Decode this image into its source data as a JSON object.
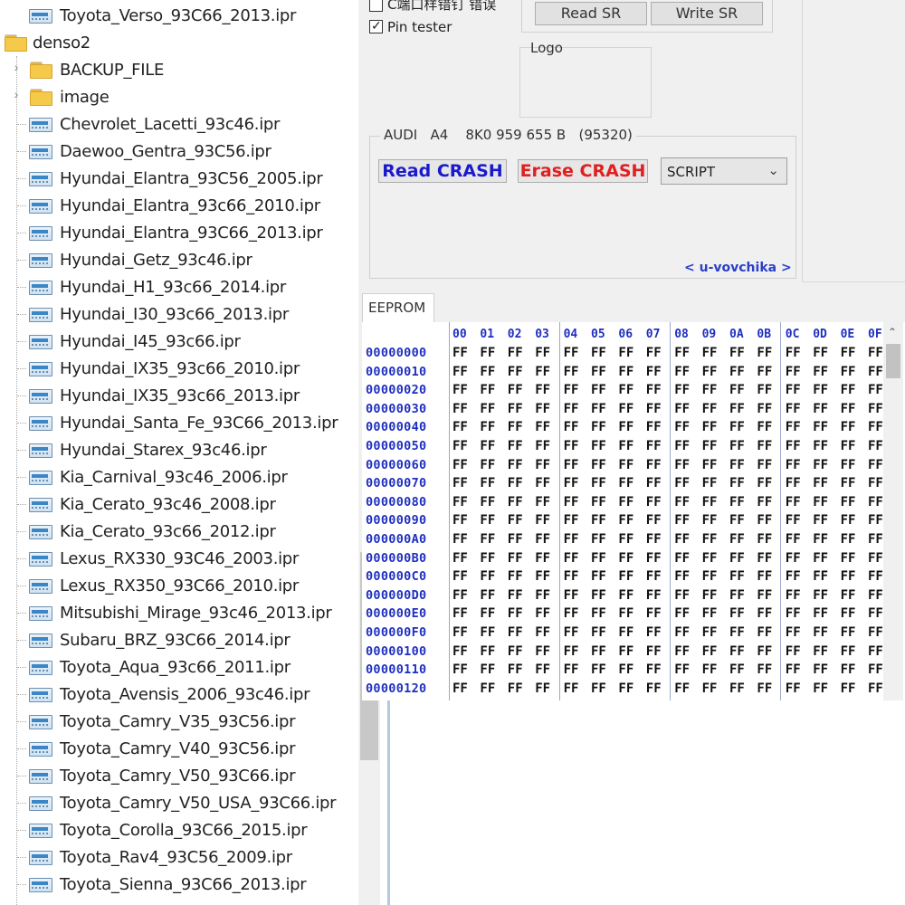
{
  "tree": {
    "top_file": "Toyota_Verso_93C66_2013.ipr",
    "root_folder": "denso2",
    "folders": [
      "BACKUP_FILE",
      "image"
    ],
    "files": [
      "Chevrolet_Lacetti_93c46.ipr",
      "Daewoo_Gentra_93C56.ipr",
      "Hyundai_Elantra_93C56_2005.ipr",
      "Hyundai_Elantra_93c66_2010.ipr",
      "Hyundai_Elantra_93C66_2013.ipr",
      "Hyundai_Getz_93c46.ipr",
      "Hyundai_H1_93c66_2014.ipr",
      "Hyundai_I30_93c66_2013.ipr",
      "Hyundai_I45_93c66.ipr",
      "Hyundai_IX35_93c66_2010.ipr",
      "Hyundai_IX35_93c66_2013.ipr",
      "Hyundai_Santa_Fe_93C66_2013.ipr",
      "Hyundai_Starex_93c46.ipr",
      "Kia_Carnival_93c46_2006.ipr",
      "Kia_Cerato_93c46_2008.ipr",
      "Kia_Cerato_93c66_2012.ipr",
      "Lexus_RX330_93C46_2003.ipr",
      "Lexus_RX350_93C66_2010.ipr",
      "Mitsubishi_Mirage_93c46_2013.ipr",
      "Subaru_BRZ_93C66_2014.ipr",
      "Toyota_Aqua_93c66_2011.ipr",
      "Toyota_Avensis_2006_93c46.ipr",
      "Toyota_Camry_V35_93C56.ipr",
      "Toyota_Camry_V40_93C56.ipr",
      "Toyota_Camry_V50_93C66.ipr",
      "Toyota_Camry_V50_USA_93C66.ipr",
      "Toyota_Corolla_93C66_2015.ipr",
      "Toyota_Rav4_93C56_2009.ipr",
      "Toyota_Sienna_93C66_2013.ipr"
    ]
  },
  "controls": {
    "partial_checkbox_label": "C端口样错钉 错误",
    "pin_tester_label": "Pin tester",
    "pin_tester_checked": true,
    "read_sr": "Read SR",
    "write_sr": "Write SR",
    "logo_label": "Logo",
    "car_info": "AUDI   A4    8K0 959 655 B   (95320)",
    "read_crash": "Read CRASH",
    "erase_crash": "Erase CRASH",
    "script_select": "SCRIPT",
    "author_link": "< u-vovchika >",
    "read_crash_color": "#1a1acc",
    "erase_crash_color": "#e02020"
  },
  "eeprom": {
    "tab_label": "EEPROM",
    "columns": [
      "00",
      "01",
      "02",
      "03",
      "04",
      "05",
      "06",
      "07",
      "08",
      "09",
      "0A",
      "0B",
      "0C",
      "0D",
      "0E",
      "0F"
    ],
    "addresses": [
      "00000000",
      "00000010",
      "00000020",
      "00000030",
      "00000040",
      "00000050",
      "00000060",
      "00000070",
      "00000080",
      "00000090",
      "000000A0",
      "000000B0",
      "000000C0",
      "000000D0",
      "000000E0",
      "000000F0",
      "00000100",
      "00000110",
      "00000120"
    ],
    "fill_value": "FF"
  }
}
